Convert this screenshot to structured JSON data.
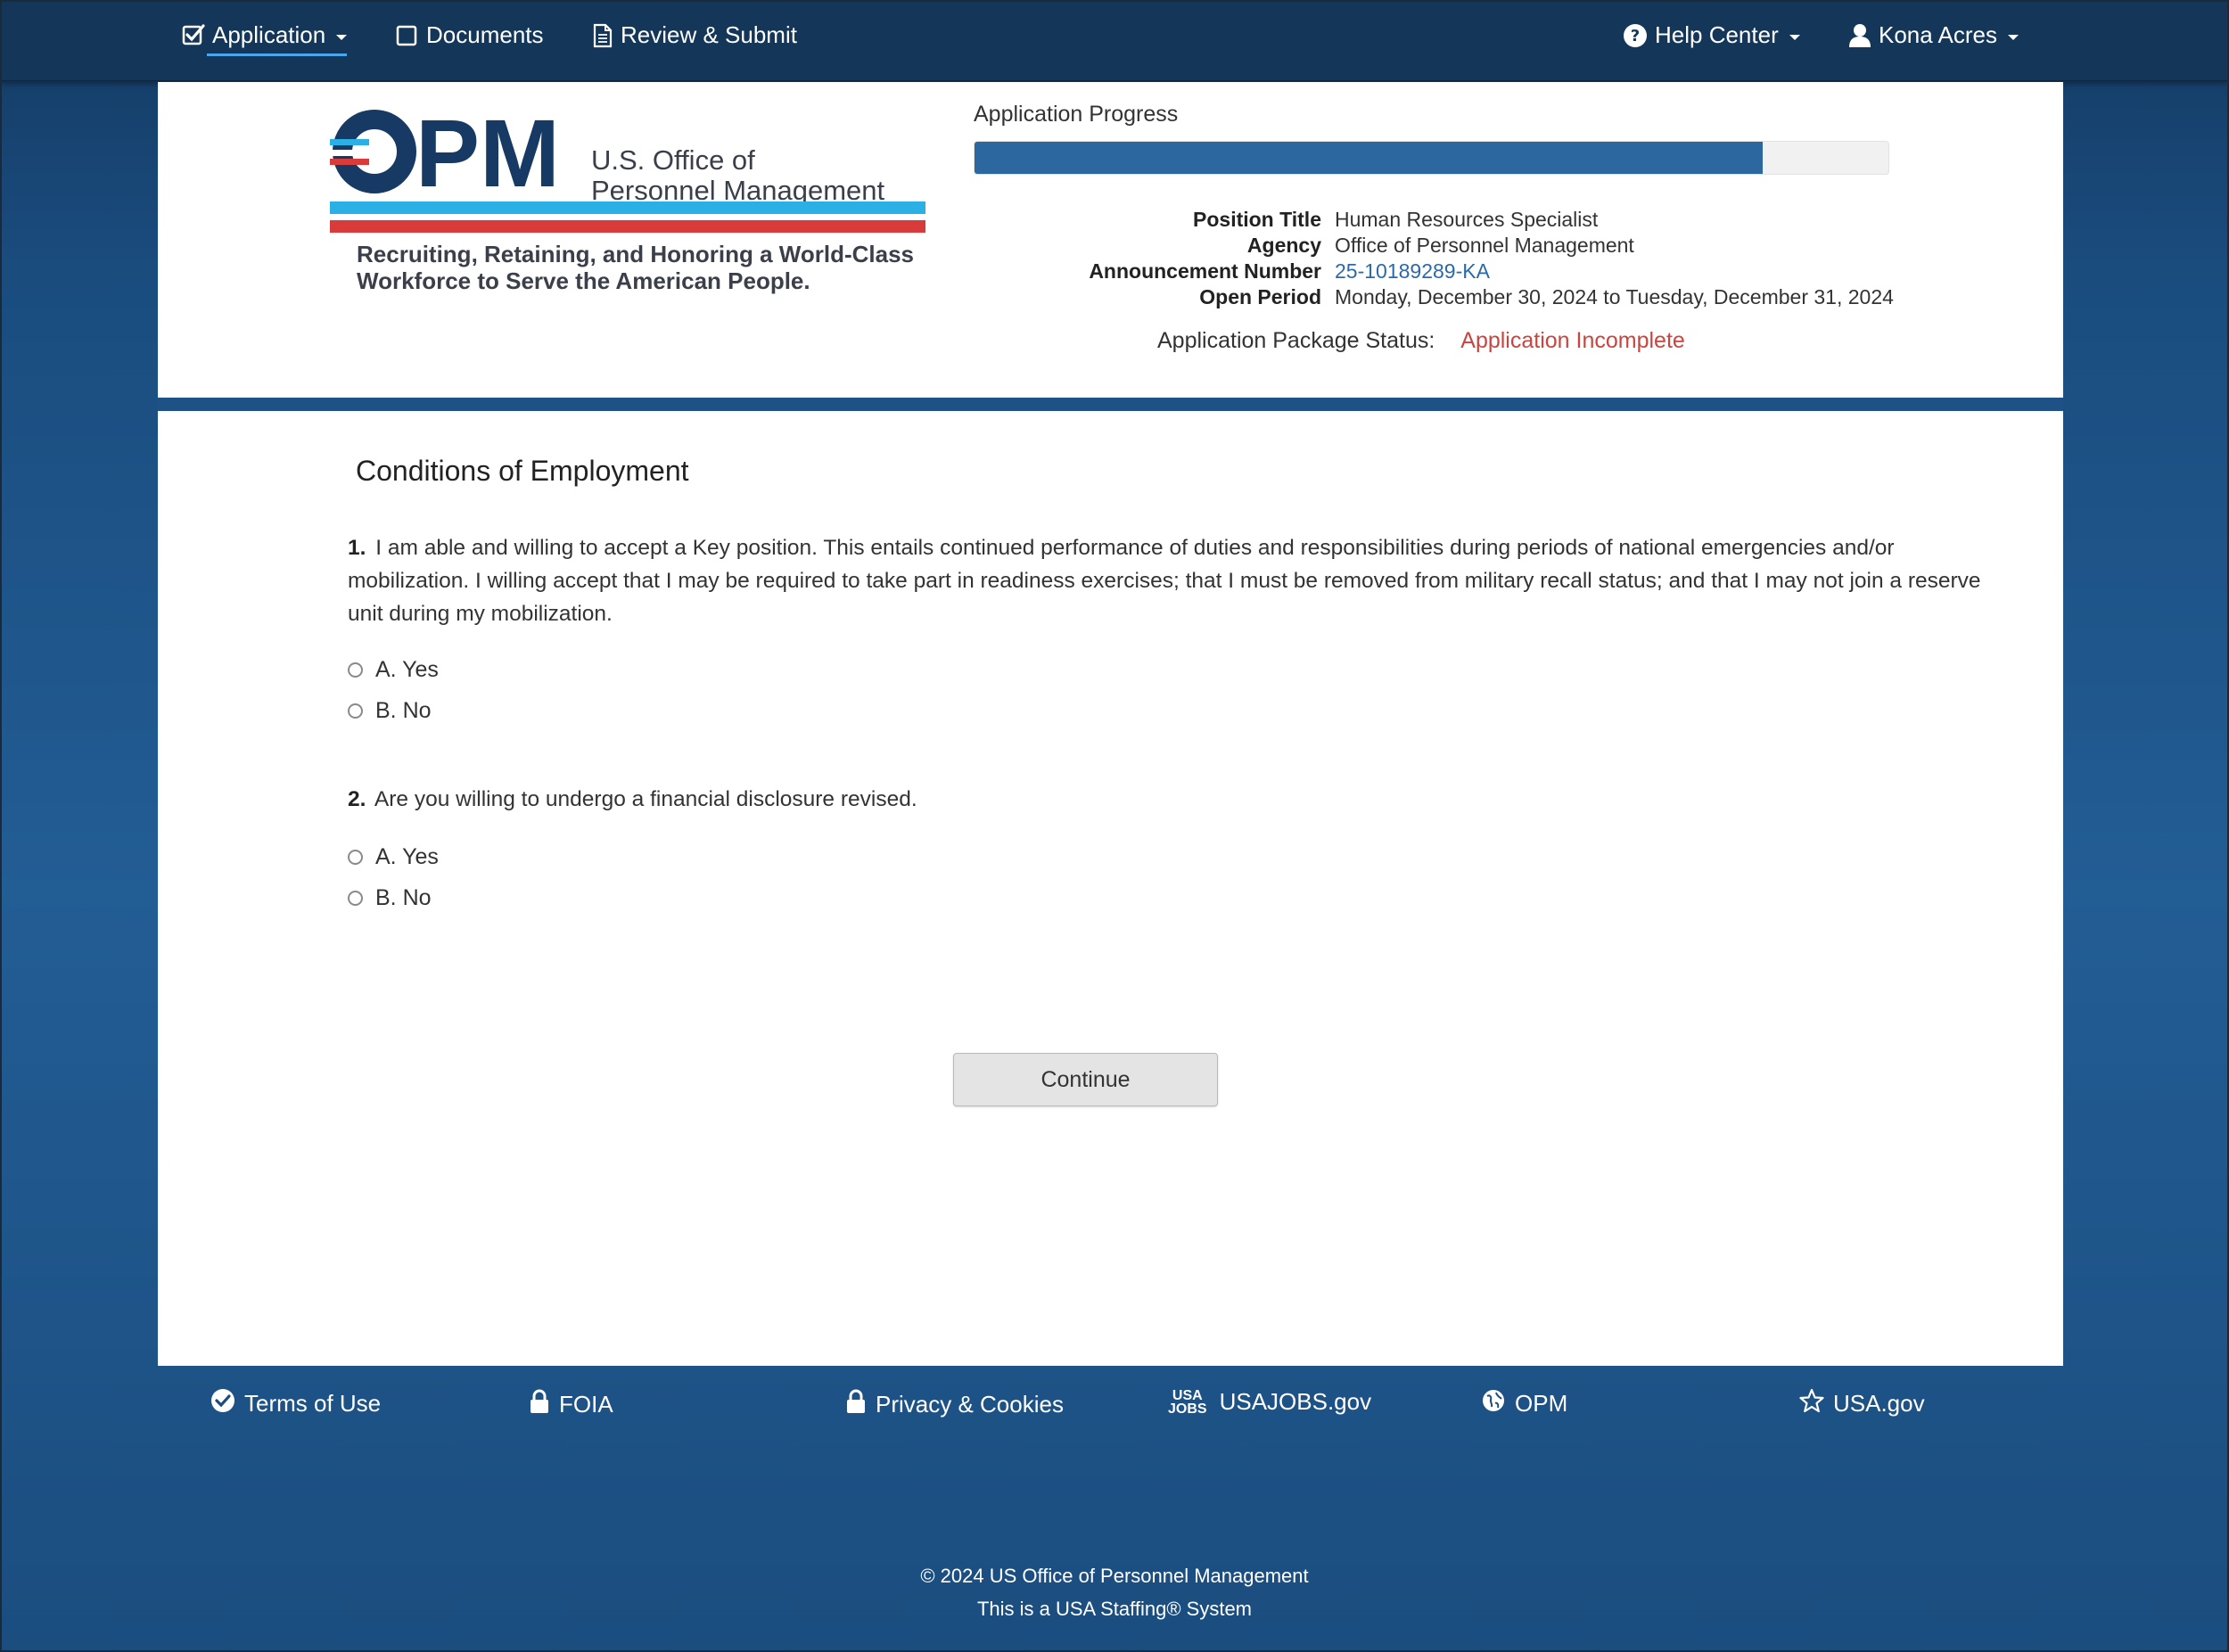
{
  "nav": {
    "application": "Application",
    "documents": "Documents",
    "review_submit": "Review & Submit",
    "help_center": "Help Center",
    "user_name": "Kona Acres"
  },
  "logo": {
    "wordmark": "OPM",
    "org_line1": "U.S. Office of",
    "org_line2": "Personnel Management",
    "tagline": "Recruiting, Retaining, and Honoring a World-Class Workforce to Serve the American People."
  },
  "progress": {
    "label": "Application Progress",
    "fraction": 0.862
  },
  "job": {
    "position_title_label": "Position Title",
    "position_title": "Human Resources Specialist",
    "agency_label": "Agency",
    "agency": "Office of Personnel Management",
    "announcement_label": "Announcement Number",
    "announcement_number": "25-10189289-KA",
    "open_period_label": "Open Period",
    "open_period": "Monday, December 30, 2024 to Tuesday, December 31, 2024"
  },
  "status": {
    "label": "Application Package Status:",
    "value": "Application Incomplete",
    "color": "#c9453f"
  },
  "form": {
    "title": "Conditions of Employment",
    "questions": [
      {
        "number": "1.",
        "text": "I am able and willing to accept a Key position. This entails continued performance of duties and responsibilities during periods of national emergencies and/or mobilization. I willing accept that I may be required to take part in readiness exercises; that I must be removed from military recall status; and that I may not join a reserve unit during my mobilization.",
        "options": [
          "A. Yes",
          "B. No"
        ]
      },
      {
        "number": "2.",
        "text": "Are you willing to undergo a financial disclosure revised.",
        "options": [
          "A. Yes",
          "B. No"
        ]
      }
    ],
    "continue_label": "Continue"
  },
  "footer": {
    "links": [
      "Terms of Use",
      "FOIA",
      "Privacy & Cookies",
      "USAJOBS.gov",
      "OPM",
      "USA.gov"
    ],
    "usajobs_mark_top": "USA",
    "usajobs_mark_bottom": "JOBS",
    "copyright": "© 2024 US Office of Personnel Management",
    "system_note": "This is a USA Staffing® System"
  },
  "colors": {
    "nav_bg": "#143659",
    "accent_blue": "#1e5185",
    "link": "#2b6aa8",
    "stripe_blue": "#2bb0e6",
    "stripe_red": "#d93a3a"
  }
}
